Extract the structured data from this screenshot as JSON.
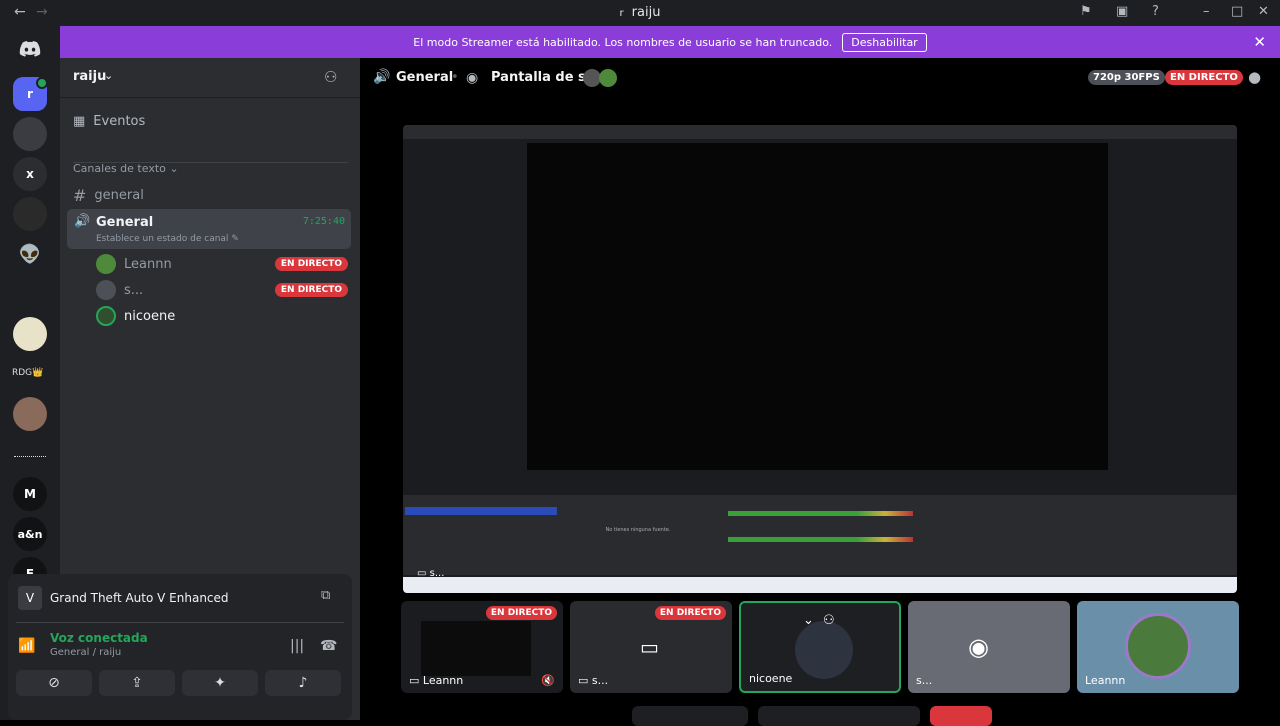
{
  "titlebar": {
    "title": "raiju",
    "prefix_icon": "r"
  },
  "rail": {
    "x_label": "x",
    "rdg_label": "RDG👑",
    "m_label": "M",
    "an_label": "a&n",
    "e_label": "E"
  },
  "banner": {
    "text": "El modo Streamer está habilitado. Los nombres de usuario se han truncado.",
    "button": "Deshabilitar"
  },
  "sidebar": {
    "server_name": "raiju",
    "events": "Eventos",
    "category": "Canales de texto",
    "text_channel": "general",
    "voice_channel": {
      "name": "General",
      "time": "7:25:40",
      "status": "Establece un estado de canal"
    },
    "members": [
      {
        "name": "Leannn",
        "live": "EN DIRECTO"
      },
      {
        "name": "s...",
        "live": "EN DIRECTO"
      },
      {
        "name": "nicoene",
        "live": ""
      }
    ]
  },
  "panel": {
    "activity": "Grand Theft Auto V Enhanced",
    "voice_status": "Voz conectada",
    "voice_location": "General / raiju"
  },
  "main": {
    "channel": "General",
    "stream_title": "Pantalla de s...",
    "quality": "720p 30FPS",
    "live": "EN DIRECTO"
  },
  "stream": {
    "no_sources": "No tienes ninguna fuente.",
    "label": "s..."
  },
  "tiles": [
    {
      "label": "Leannn",
      "live": "EN DIRECTO"
    },
    {
      "label": "s...",
      "live": "EN DIRECTO"
    },
    {
      "label": "nicoene",
      "live": ""
    },
    {
      "label": "s...",
      "live": ""
    },
    {
      "label": "Leannn",
      "live": ""
    }
  ]
}
